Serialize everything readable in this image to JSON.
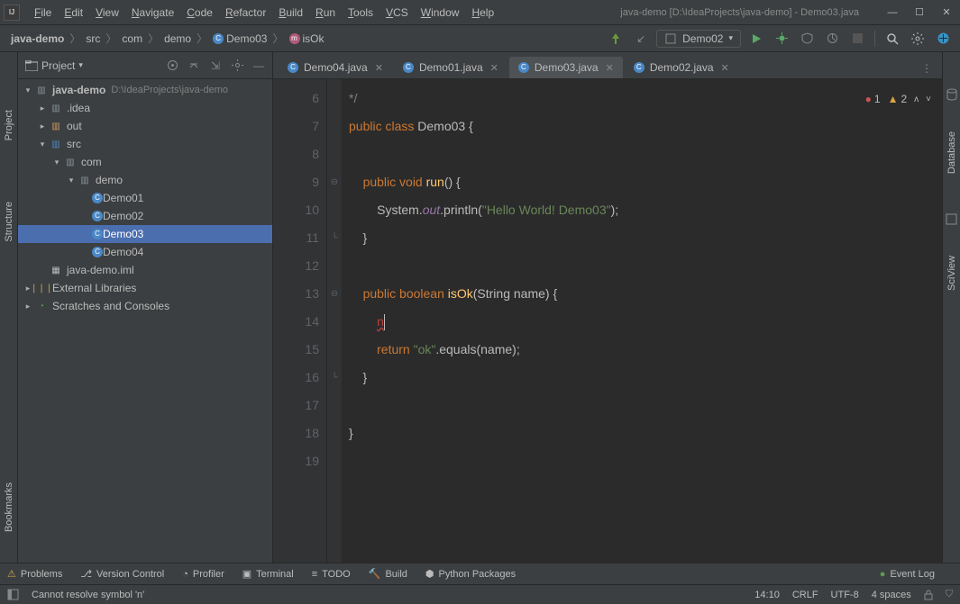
{
  "title": {
    "path": "java-demo [D:\\IdeaProjects\\java-demo] - Demo03.java"
  },
  "menu": [
    "File",
    "Edit",
    "View",
    "Navigate",
    "Code",
    "Refactor",
    "Build",
    "Run",
    "Tools",
    "VCS",
    "Window",
    "Help"
  ],
  "breadcrumbs": [
    {
      "label": "java-demo",
      "bold": true
    },
    {
      "label": "src"
    },
    {
      "label": "com"
    },
    {
      "label": "demo"
    },
    {
      "label": "Demo03",
      "icon": "C",
      "color": "#4a88c7"
    },
    {
      "label": "isOk",
      "icon": "m",
      "color": "#b05a78"
    }
  ],
  "run_config": "Demo02",
  "project_panel": {
    "title": "Project"
  },
  "tree": [
    {
      "depth": 0,
      "arrow": "v",
      "icon": "folder-dark",
      "label": "java-demo",
      "muted": "D:\\IdeaProjects\\java-demo",
      "bold": true
    },
    {
      "depth": 1,
      "arrow": ">",
      "icon": "folder-dark",
      "label": ".idea"
    },
    {
      "depth": 1,
      "arrow": ">",
      "icon": "folder-orange",
      "label": "out"
    },
    {
      "depth": 1,
      "arrow": "v",
      "icon": "folder-blue",
      "label": "src"
    },
    {
      "depth": 2,
      "arrow": "v",
      "icon": "folder-dark",
      "label": "com"
    },
    {
      "depth": 3,
      "arrow": "v",
      "icon": "folder-dark",
      "label": "demo"
    },
    {
      "depth": 4,
      "arrow": "",
      "icon": "java",
      "label": "Demo01"
    },
    {
      "depth": 4,
      "arrow": "",
      "icon": "java",
      "label": "Demo02"
    },
    {
      "depth": 4,
      "arrow": "",
      "icon": "java",
      "label": "Demo03",
      "selected": true
    },
    {
      "depth": 4,
      "arrow": "",
      "icon": "java",
      "label": "Demo04"
    },
    {
      "depth": 1,
      "arrow": "",
      "icon": "file",
      "label": "java-demo.iml"
    },
    {
      "depth": 0,
      "arrow": ">",
      "icon": "lib",
      "label": "External Libraries"
    },
    {
      "depth": 0,
      "arrow": ">",
      "icon": "scratch",
      "label": "Scratches and Consoles"
    }
  ],
  "tabs": [
    {
      "label": "Demo04.java"
    },
    {
      "label": "Demo01.java"
    },
    {
      "label": "Demo03.java",
      "active": true
    },
    {
      "label": "Demo02.java"
    }
  ],
  "inspection": {
    "errors": "1",
    "warnings": "2"
  },
  "gutter_start": 6,
  "gutter_end": 19,
  "code": [
    {
      "html": "<span class='k-grey'>*/</span>",
      "fold": ""
    },
    {
      "html": "<span class='k-orange'>public class </span><span>Demo03 {</span>",
      "fold": ""
    },
    {
      "html": "",
      "fold": ""
    },
    {
      "html": "    <span class='k-orange'>public void </span><span class='k-yellow'>run</span>() {",
      "fold": "-"
    },
    {
      "html": "        System.<span class='k-purple'>out</span>.println(<span class='k-green'>\"Hello World! Demo03\"</span>);",
      "fold": ""
    },
    {
      "html": "    }",
      "fold": "^"
    },
    {
      "html": "",
      "fold": ""
    },
    {
      "html": "    <span class='k-orange'>public boolean </span><span class='k-yellow'>isOk</span>(String name) {",
      "fold": "-"
    },
    {
      "html": "        <span class='k-red'>n</span><span class='cursor'></span>",
      "fold": ""
    },
    {
      "html": "        <span class='k-orange'>return </span><span class='k-green'>\"ok\"</span>.equals(name);",
      "fold": ""
    },
    {
      "html": "    }",
      "fold": "^"
    },
    {
      "html": "",
      "fold": ""
    },
    {
      "html": "}",
      "fold": ""
    },
    {
      "html": "",
      "fold": ""
    }
  ],
  "bottom_tools": [
    {
      "label": "Problems",
      "icon": "!"
    },
    {
      "label": "Version Control",
      "icon": "br"
    },
    {
      "label": "Profiler",
      "icon": "pf"
    },
    {
      "label": "Terminal",
      "icon": ">_"
    },
    {
      "label": "TODO",
      "icon": "td"
    },
    {
      "label": "Build",
      "icon": "hm"
    },
    {
      "label": "Python Packages",
      "icon": "py"
    }
  ],
  "event_log": "Event Log",
  "status": {
    "msg": "Cannot resolve symbol 'n'",
    "pos": "14:10",
    "eol": "CRLF",
    "enc": "UTF-8",
    "indent": "4 spaces"
  }
}
